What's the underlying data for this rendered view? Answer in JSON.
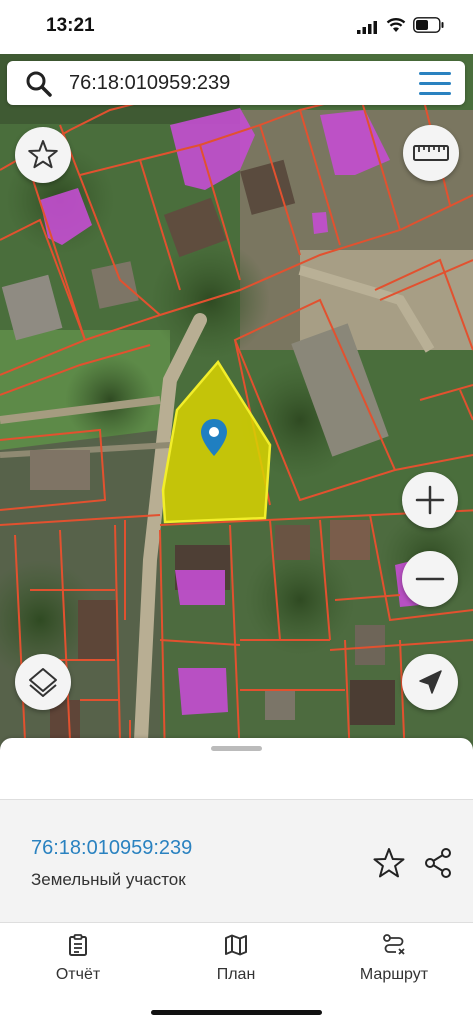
{
  "status_bar": {
    "time": "13:21",
    "icons": [
      "cellular-signal-icon",
      "wifi-icon",
      "battery-icon"
    ]
  },
  "search": {
    "value": "76:18:010959:239",
    "placeholder": "",
    "left_icon": "search-icon",
    "right_icon": "hamburger-menu-icon"
  },
  "map": {
    "colors": {
      "parcel_border": "#e2512f",
      "selected_fill": "#d9d400",
      "selected_border": "#f2ee2a",
      "building_highlight": "#c44ed2",
      "pin": "#1f7fc1"
    },
    "controls": [
      {
        "name": "favorites-button",
        "icon": "star-outline-icon"
      },
      {
        "name": "ruler-button",
        "icon": "ruler-icon"
      },
      {
        "name": "zoom-in-button",
        "icon": "plus-icon"
      },
      {
        "name": "zoom-out-button",
        "icon": "minus-icon"
      },
      {
        "name": "layers-button",
        "icon": "layers-icon"
      },
      {
        "name": "locate-button",
        "icon": "navigation-arrow-icon"
      }
    ]
  },
  "sheet": {
    "parcel_number": "76:18:010959:239",
    "parcel_type": "Земельный участок",
    "actions": [
      {
        "name": "favorite",
        "icon": "star-outline-icon"
      },
      {
        "name": "share",
        "icon": "share-icon"
      }
    ]
  },
  "tabs": [
    {
      "label": "Отчёт",
      "icon": "clipboard-report-icon"
    },
    {
      "label": "План",
      "icon": "map-fold-icon"
    },
    {
      "label": "Маршрут",
      "icon": "route-icon"
    }
  ],
  "colors": {
    "accent": "#2a82c0",
    "menu_icon": "#2a82c0"
  }
}
